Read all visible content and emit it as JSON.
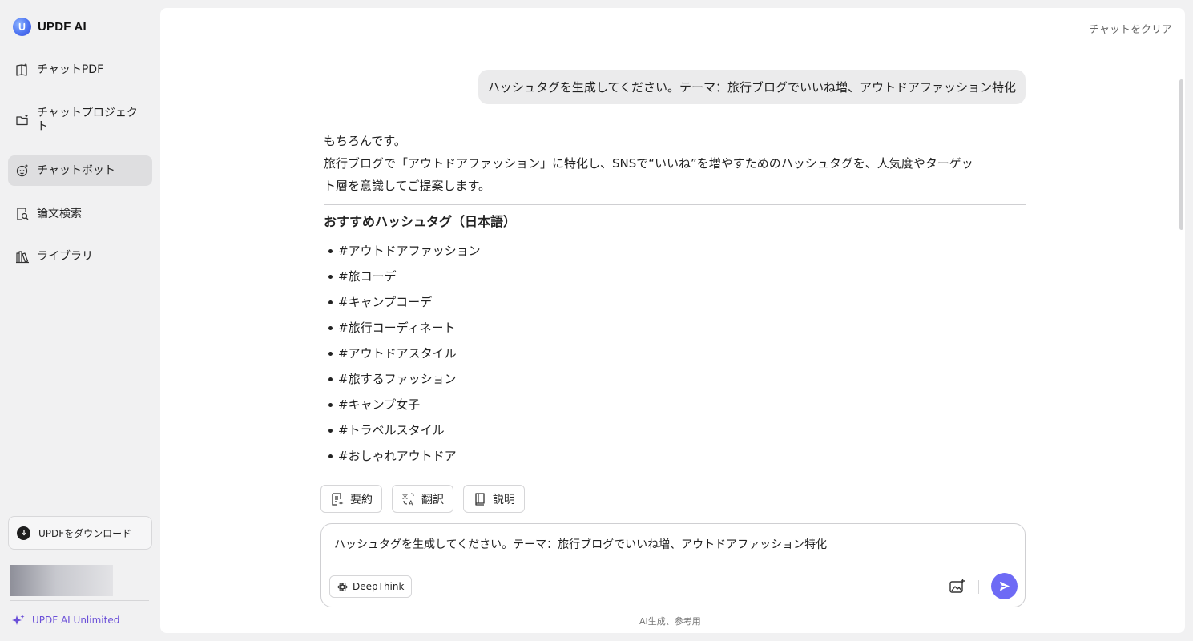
{
  "app": {
    "name": "UPDF AI"
  },
  "sidebar": {
    "items": [
      {
        "label": "チャットPDF",
        "icon": "book-icon",
        "active": false
      },
      {
        "label": "チャットプロジェクト",
        "icon": "folder-icon",
        "active": false
      },
      {
        "label": "チャットボット",
        "icon": "bot-icon",
        "active": true
      },
      {
        "label": "論文検索",
        "icon": "paper-search-icon",
        "active": false
      },
      {
        "label": "ライブラリ",
        "icon": "library-icon",
        "active": false
      }
    ],
    "download_label": "UPDFをダウンロード",
    "plan_label": "UPDF AI Unlimited"
  },
  "header": {
    "clear_label": "チャットをクリア"
  },
  "conversation": {
    "user_message": "ハッシュタグを生成してください。テーマ：旅行ブログでいいね増、アウトドアファッション特化",
    "answer": {
      "intro_line1": "もちろんです。",
      "intro_line2a": "旅行ブログで「アウトドアファッション」に特化し、SNSで“いいね”を増やすためのハッシュタグを、人気度やターゲッ",
      "intro_line2b": "ト層を意識してご提案します。",
      "section_title": "おすすめハッシュタグ（日本語）",
      "tags": [
        "#アウトドアファッション",
        "#旅コーデ",
        "#キャンプコーデ",
        "#旅行コーディネート",
        "#アウトドアスタイル",
        "#旅するファッション",
        "#キャンプ女子",
        "#トラベルスタイル",
        "#おしゃれアウトドア"
      ]
    }
  },
  "actions": {
    "summary": "要約",
    "translate": "翻訳",
    "explain": "説明"
  },
  "composer": {
    "value": "ハッシュタグを生成してください。テーマ：旅行ブログでいいね増、アウトドアファッション特化",
    "deepthink_label": "DeepThink"
  },
  "footer": {
    "disclaimer": "AI生成、参考用"
  },
  "colors": {
    "accent": "#6e6af5",
    "plan": "#6a4fd8",
    "active_nav": "#dedee0"
  }
}
